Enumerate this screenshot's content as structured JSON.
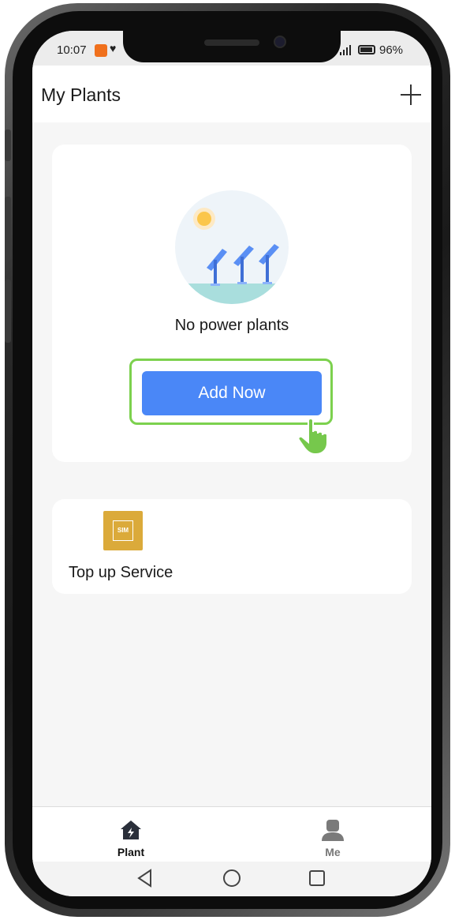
{
  "status_bar": {
    "time": "10:07",
    "battery": "96%"
  },
  "header": {
    "title": "My Plants",
    "add_icon": "plus-icon"
  },
  "plant_card": {
    "empty_text": "No power plants",
    "add_button_label": "Add Now",
    "illustration": "solar-panels-illustration"
  },
  "topup_card": {
    "icon": "sim-card-icon",
    "icon_text": "SIM",
    "label": "Top up Service"
  },
  "bottom_nav": {
    "items": [
      {
        "label": "Plant",
        "icon": "home-bolt-icon",
        "active": true
      },
      {
        "label": "Me",
        "icon": "person-icon",
        "active": false
      }
    ]
  },
  "system_nav": {
    "buttons": [
      "back-icon",
      "home-icon",
      "recents-icon"
    ]
  },
  "colors": {
    "accent": "#4a87f7",
    "highlight": "#7cd14e",
    "sim_icon_bg": "#dbaa3a",
    "background": "#f6f6f6"
  }
}
